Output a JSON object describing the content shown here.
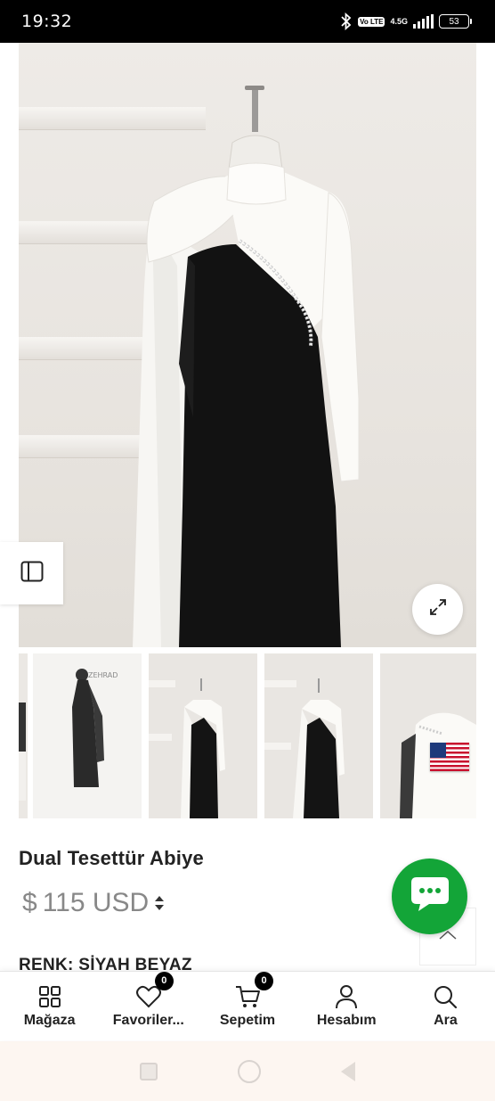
{
  "status_bar": {
    "time": "19:32",
    "volte": "Vo LTE",
    "network": "4.5G",
    "battery": "53"
  },
  "product": {
    "title": "Dual Tesettür Abiye",
    "price_symbol": "$",
    "price": "115 USD",
    "color_label": "RENK: SİYAH BEYAZ",
    "thumbnail_watermark": "ZEHRAD"
  },
  "bottom_nav": {
    "items": [
      {
        "label": "Mağaza",
        "icon": "grid-icon",
        "badge": null
      },
      {
        "label": "Favoriler...",
        "icon": "heart-icon",
        "badge": "0"
      },
      {
        "label": "Sepetim",
        "icon": "cart-icon",
        "badge": "0"
      },
      {
        "label": "Hesabım",
        "icon": "user-icon",
        "badge": null
      },
      {
        "label": "Ara",
        "icon": "search-icon",
        "badge": null
      }
    ]
  },
  "colors": {
    "chat_green": "#13a538",
    "badge_black": "#000000",
    "price_gray": "#888888"
  }
}
